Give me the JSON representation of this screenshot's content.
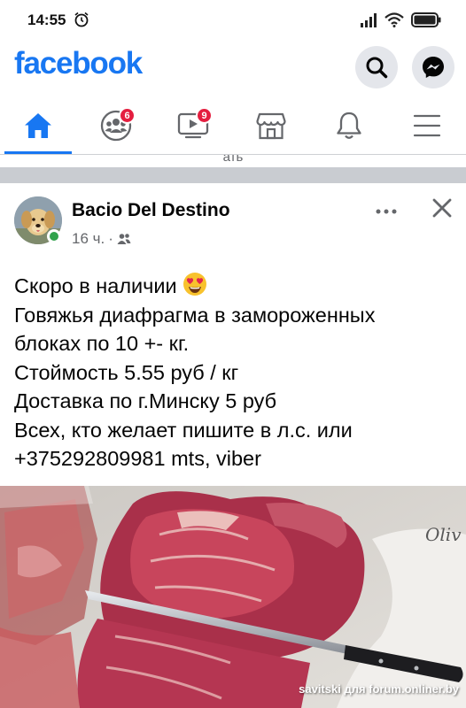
{
  "status_bar": {
    "time": "14:55",
    "icons": [
      "alarm-icon",
      "signal-icon",
      "wifi-icon",
      "battery-icon"
    ]
  },
  "header": {
    "logo": "facebook",
    "brand_color": "#1877f2",
    "buttons": [
      "search-icon",
      "messenger-icon"
    ]
  },
  "nav": {
    "tabs": [
      {
        "name": "home",
        "icon": "home-icon",
        "active": true
      },
      {
        "name": "groups",
        "icon": "groups-icon",
        "badge": "6"
      },
      {
        "name": "watch",
        "icon": "video-icon",
        "badge": "9"
      },
      {
        "name": "marketplace",
        "icon": "marketplace-icon"
      },
      {
        "name": "notifications",
        "icon": "bell-icon"
      },
      {
        "name": "menu",
        "icon": "hamburger-icon"
      }
    ]
  },
  "previous_post_snippet": "ать",
  "post": {
    "author": "Bacio Del Destino",
    "time": "16 ч.",
    "privacy_icon": "friends-icon",
    "text_lines": [
      "Скоро в наличии",
      "Говяжья диафрагма в замороженных",
      "блоках по 10 +- кг.",
      "Стоймость 5.55 руб / кг",
      "Доставка по г.Минску 5 руб",
      "Всех, кто желает пишите в л.с. или",
      "+375292809981 mts, viber"
    ],
    "emoji": "heart-eyes-emoji",
    "photo_label": "Oliv",
    "watermark": "savitski для forum.onliner.by"
  }
}
